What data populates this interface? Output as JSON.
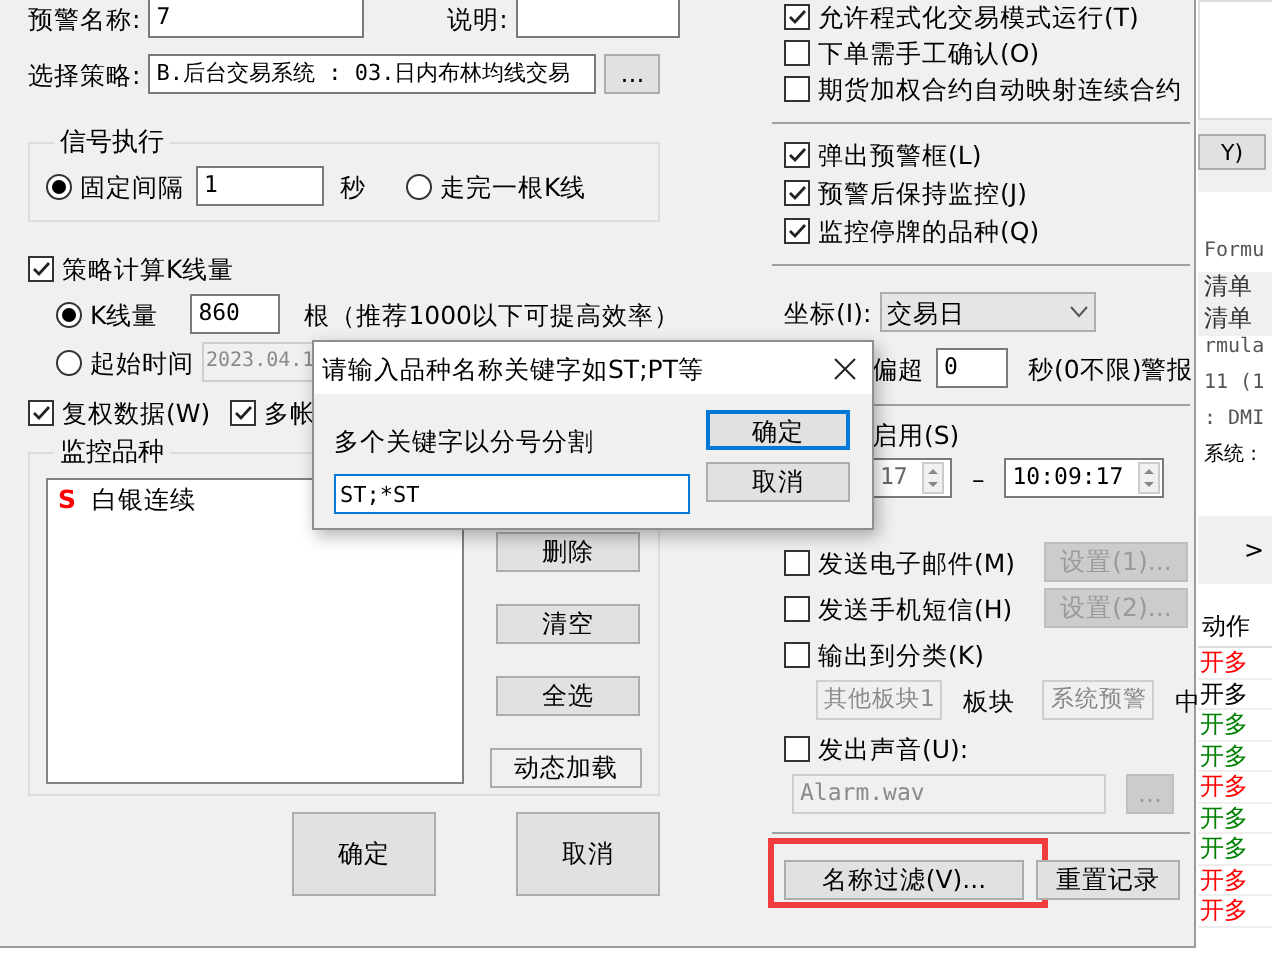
{
  "main": {
    "name_field": {
      "label": "预警名称:",
      "value": "7"
    },
    "note_field": {
      "label": "说明:"
    },
    "strategy": {
      "label": "选择策略:",
      "value": "B.后台交易系统 : 03.日内布林均线交易",
      "browse": "..."
    },
    "signal": {
      "title": "信号执行",
      "modes": [
        {
          "label": "固定间隔",
          "selected": true
        },
        {
          "label": "走完一根K线",
          "selected": false
        }
      ],
      "interval": "1",
      "unit": "秒"
    },
    "kline": {
      "label": "策略计算K线量",
      "checked": true,
      "modes": [
        {
          "label": "K线量",
          "selected": true,
          "value": "860",
          "note": "根（推荐1000以下可提高效率）"
        },
        {
          "label": "起始时间",
          "selected": false,
          "value": "2023.04.1"
        }
      ]
    },
    "flags": [
      {
        "label": "复权数据(W)",
        "checked": true
      },
      {
        "label": "多帐",
        "checked": true
      }
    ],
    "watchlist": {
      "title": "监控品种",
      "items": [
        {
          "tag": "S",
          "name": "白银连续"
        }
      ],
      "buttons": [
        "删除",
        "清空",
        "全选",
        "动态加载"
      ]
    },
    "footer": [
      "确定",
      "取消"
    ],
    "options_a": [
      {
        "label": "允许程式化交易模式运行(T)",
        "checked": true
      },
      {
        "label": "下单需手工确认(O)",
        "checked": false
      },
      {
        "label": "期货加权合约自动映射连续合约",
        "checked": false
      }
    ],
    "options_b": [
      {
        "label": "弹出预警框(L)",
        "checked": true
      },
      {
        "label": "预警后保持监控(J)",
        "checked": true
      },
      {
        "label": "监控停牌的品种(Q)",
        "checked": true
      }
    ],
    "axis": {
      "label": "坐标(I):",
      "value": "交易日"
    },
    "timeout": {
      "label": "偏超",
      "value": "0",
      "unit": "秒(0不限)警报"
    },
    "schedule": {
      "label": "启用(S)",
      "start": "17",
      "dash": "–",
      "end": "10:09:17"
    },
    "notify": [
      {
        "kind": "button",
        "label": "发送电子邮件(M)",
        "checked": false,
        "button": {
          "label": "设置(1)...",
          "disabled": true
        }
      },
      {
        "kind": "button",
        "label": "发送手机短信(H)",
        "checked": false,
        "button": {
          "label": "设置(2)...",
          "disabled": true
        }
      },
      {
        "kind": "category",
        "label": "输出到分类(K)",
        "checked": false,
        "board": {
          "value": "其他板块1",
          "disabled": true
        },
        "board_label": "板块",
        "target": {
          "value": "系统预警",
          "disabled": true
        },
        "suffix": "中"
      },
      {
        "kind": "file",
        "label": "发出声音(U):",
        "checked": false,
        "file": {
          "value": "Alarm.wav",
          "disabled": true
        },
        "browse": "..."
      }
    ],
    "actions": [
      {
        "label": "名称过滤(V)...",
        "highlighted": true
      },
      {
        "label": "重置记录",
        "highlighted": false
      }
    ]
  },
  "popup": {
    "title": "请输入品种名称关键字如ST;PT等",
    "prompt": "多个关键字以分号分割",
    "value": "ST;*ST",
    "buttons": [
      {
        "label": "确定",
        "default": true
      },
      {
        "label": "取消",
        "default": false
      }
    ]
  },
  "background": {
    "button": "Y)",
    "lines": [
      "Formu",
      "清单",
      "清单",
      "rmula",
      "11 (1",
      ": DMI",
      "系统 :"
    ],
    "chevron": ">",
    "header": "动作",
    "rows": [
      {
        "text": "开多",
        "color": "#ff0000"
      },
      {
        "text": "开多",
        "color": "#000000"
      },
      {
        "text": "开多",
        "color": "#008000"
      },
      {
        "text": "开多",
        "color": "#008000"
      },
      {
        "text": "开多",
        "color": "#ff0000"
      },
      {
        "text": "开多",
        "color": "#008000"
      },
      {
        "text": "开多",
        "color": "#008000"
      },
      {
        "text": "开多",
        "color": "#ff0000"
      },
      {
        "text": "开多",
        "color": "#ff0000"
      }
    ]
  }
}
